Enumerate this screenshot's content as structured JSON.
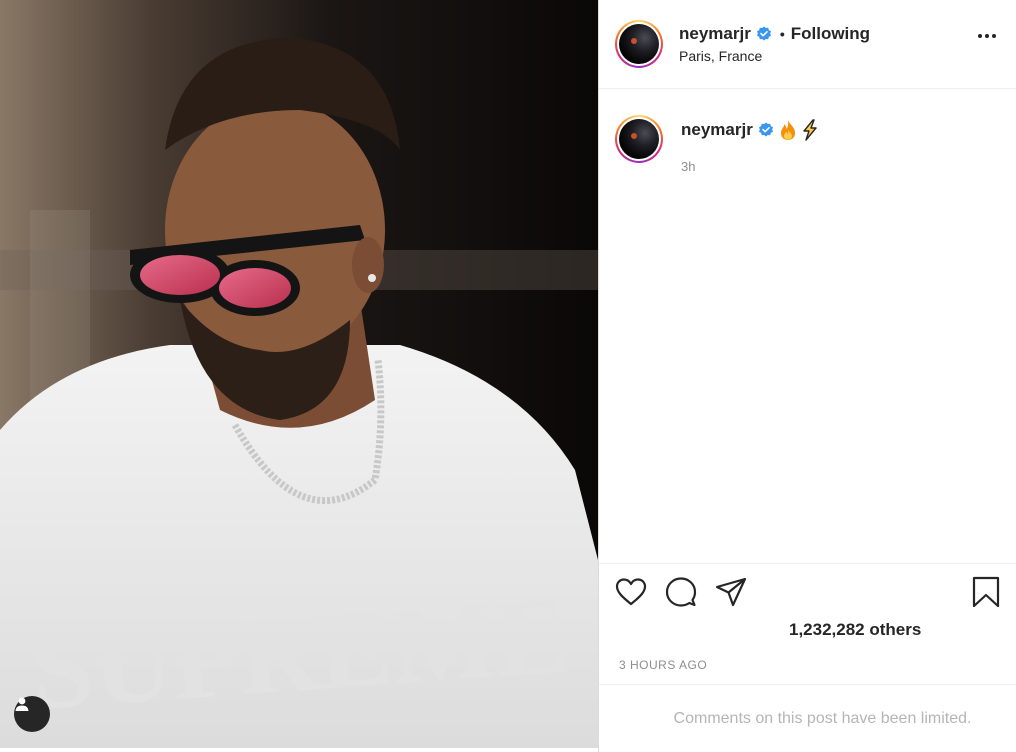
{
  "post": {
    "header": {
      "username": "neymarjr",
      "bullet": "•",
      "follow_status": "Following",
      "location": "Paris, France",
      "more_icon": "more-horizontal-icon"
    },
    "caption": {
      "username": "neymarjr",
      "emojis": [
        "fire-emoji",
        "lightning-emoji"
      ],
      "time_ago": "3h"
    },
    "actions": {
      "icons": [
        "heart-icon",
        "comment-icon",
        "share-icon",
        "bookmark-icon"
      ]
    },
    "likes_text": "1,232,282 others",
    "post_age": "3 HOURS AGO",
    "comments_notice": "Comments on this post have been limited.",
    "photo": {
      "shirt_text": "SUPREME",
      "tag_button_icon": "user-icon"
    }
  },
  "colors": {
    "verified_blue": "#3897f0",
    "text_primary": "#262626",
    "text_secondary": "#8e8e8e",
    "text_muted": "#b5b5b5"
  }
}
